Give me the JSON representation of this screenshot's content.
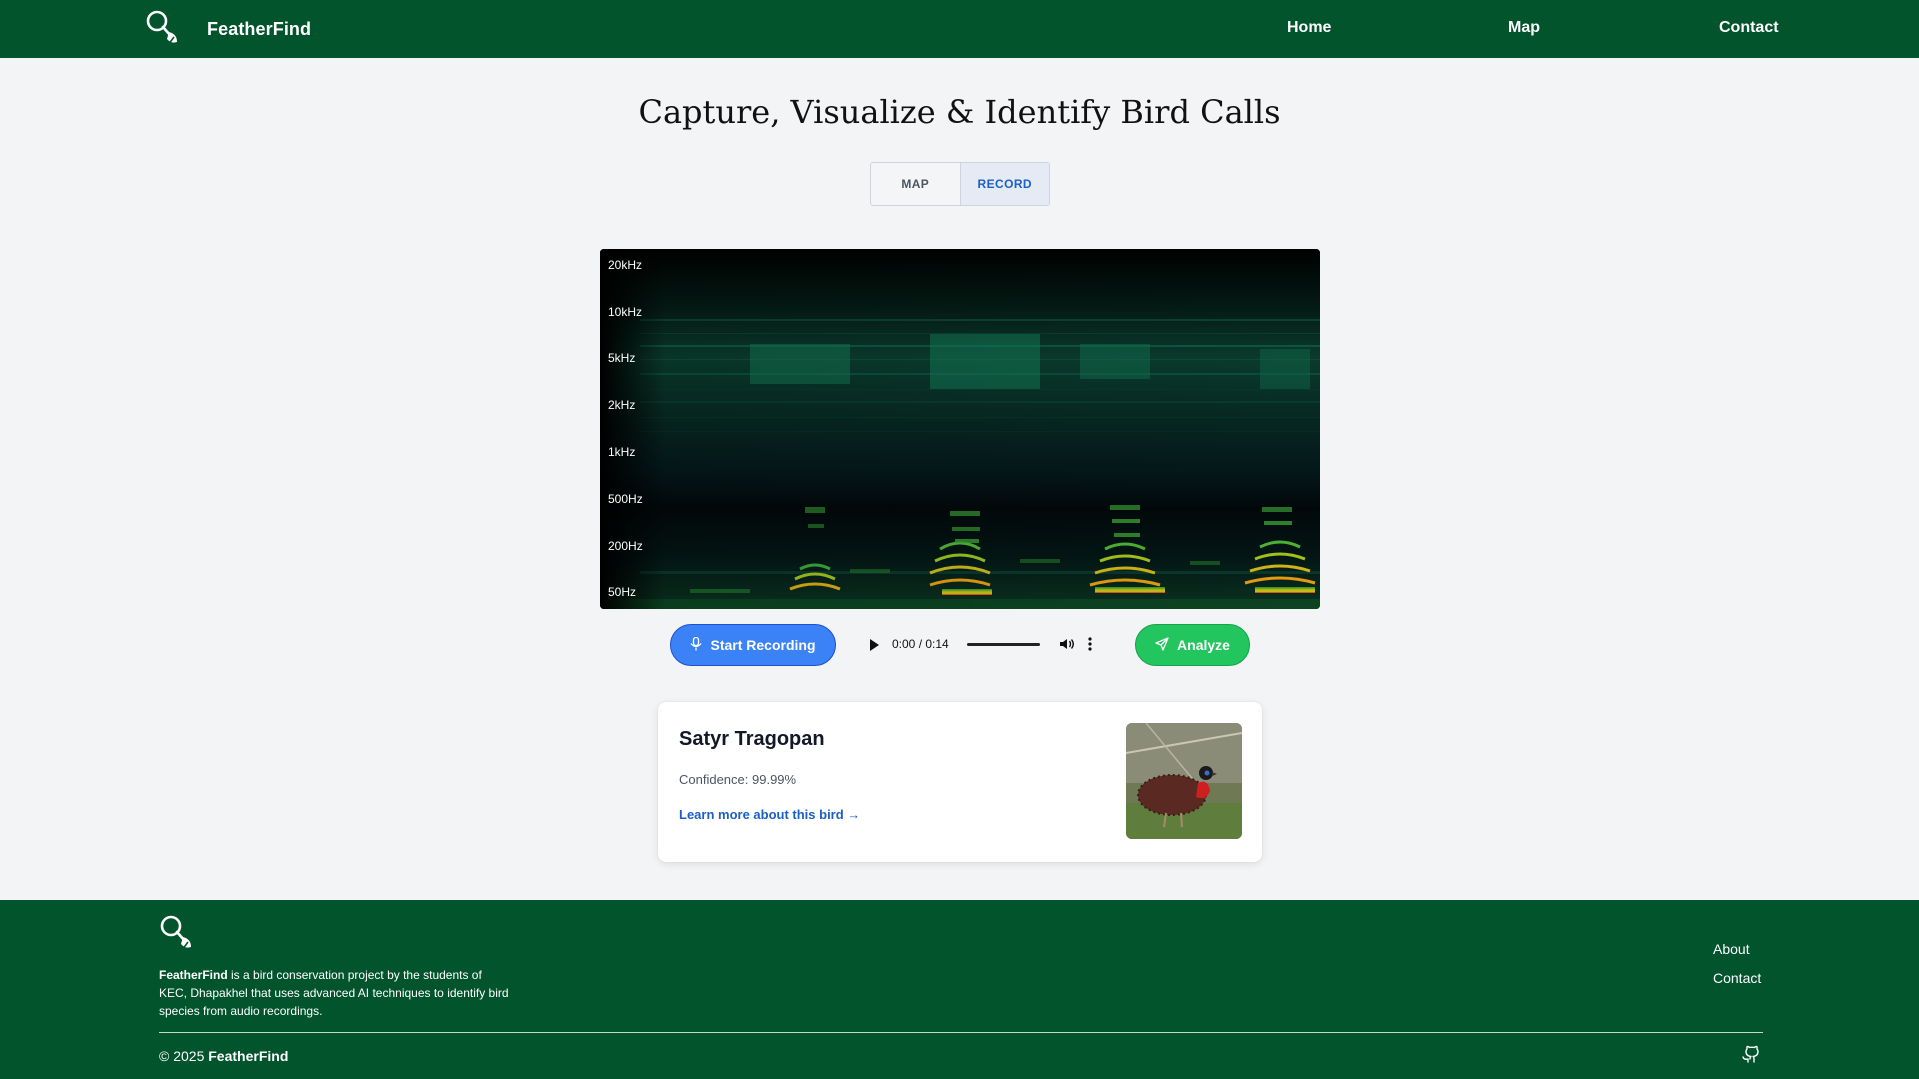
{
  "header": {
    "brand": "FeatherFind",
    "logo_icon": "magnifier-feather-icon",
    "nav": [
      "Home",
      "Map",
      "Contact"
    ]
  },
  "hero": {
    "title": "Capture, Visualize & Identify Bird Calls",
    "tabs": [
      "MAP",
      "RECORD"
    ],
    "active_tab": "RECORD"
  },
  "spectrogram": {
    "frequency_labels": [
      "20kHz",
      "10kHz",
      "5kHz",
      "2kHz",
      "1kHz",
      "500Hz",
      "200Hz",
      "50Hz"
    ]
  },
  "controls": {
    "record_label": "Start Recording",
    "record_icon": "microphone-icon",
    "audio_time": "0:00 / 0:14",
    "analyze_label": "Analyze",
    "analyze_icon": "send-icon"
  },
  "result": {
    "bird_name": "Satyr Tragopan",
    "confidence": "Confidence: 99.99%",
    "link_text": "Learn more about this bird →"
  },
  "footer": {
    "brand": "FeatherFind",
    "description": " is a bird conservation project by the students of KEC, Dhapakhel that uses advanced AI techniques to identify bird species from audio recordings.",
    "links": [
      "About",
      "Contact"
    ],
    "copyright_prefix": "© 2025 ",
    "copyright_brand": "FeatherFind",
    "github_icon": "github-icon"
  },
  "colors": {
    "header_bg": "#02542d",
    "record_button": "#3b82f6",
    "analyze_button": "#22c55e",
    "link": "#1d5fc4"
  }
}
